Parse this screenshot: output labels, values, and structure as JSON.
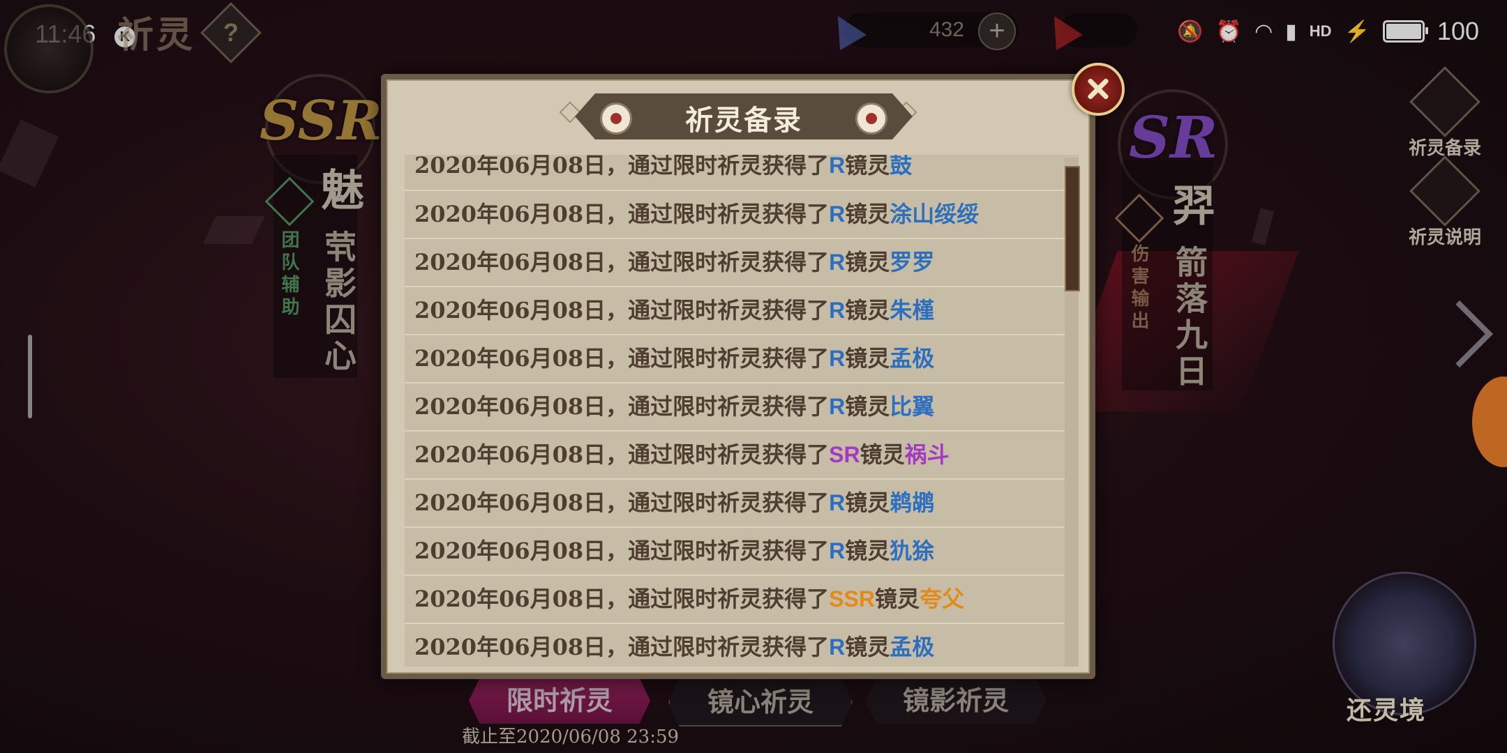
{
  "status_bar": {
    "time": "11:46",
    "notification_badge": "K",
    "battery": "100",
    "icons": [
      "mute-icon",
      "alarm-icon",
      "wifi-icon",
      "signal-icon",
      "hd-icon",
      "charging-icon"
    ]
  },
  "hud": {
    "title": "祈灵",
    "help_label": "?",
    "currency_1": {
      "value": "432",
      "plus": "+"
    },
    "currency_2": {
      "plus": "+"
    }
  },
  "left_hero": {
    "rank": "SSR",
    "name": "魅",
    "title": "茕影囚心",
    "role": "团队辅助"
  },
  "right_hero": {
    "rank": "SR",
    "name": "羿",
    "title": "箭落九日",
    "role": "伤害输出"
  },
  "side_buttons": {
    "record": "祈灵备录",
    "guide": "祈灵说明"
  },
  "realm": {
    "label": "还灵境"
  },
  "tabs": [
    {
      "label": "限时祈灵",
      "active": true
    },
    {
      "label": "镜心祈灵",
      "active": false
    },
    {
      "label": "镜影祈灵",
      "active": false
    }
  ],
  "deadline": "截止至2020/06/08 23:59",
  "modal": {
    "title": "祈灵备录",
    "entries": [
      {
        "date": "2020年06月08日，",
        "via": "通过限时祈灵获得了",
        "rarity": "R",
        "type": "镜灵",
        "name": "鼓"
      },
      {
        "date": "2020年06月08日，",
        "via": "通过限时祈灵获得了",
        "rarity": "R",
        "type": "镜灵",
        "name": "涂山绥绥"
      },
      {
        "date": "2020年06月08日，",
        "via": "通过限时祈灵获得了",
        "rarity": "R",
        "type": "镜灵",
        "name": "罗罗"
      },
      {
        "date": "2020年06月08日，",
        "via": "通过限时祈灵获得了",
        "rarity": "R",
        "type": "镜灵",
        "name": "朱槿"
      },
      {
        "date": "2020年06月08日，",
        "via": "通过限时祈灵获得了",
        "rarity": "R",
        "type": "镜灵",
        "name": "孟极"
      },
      {
        "date": "2020年06月08日，",
        "via": "通过限时祈灵获得了",
        "rarity": "R",
        "type": "镜灵",
        "name": "比翼"
      },
      {
        "date": "2020年06月08日，",
        "via": "通过限时祈灵获得了",
        "rarity": "SR",
        "type": "镜灵",
        "name": "祸斗"
      },
      {
        "date": "2020年06月08日，",
        "via": "通过限时祈灵获得了",
        "rarity": "R",
        "type": "镜灵",
        "name": "鹈鹕"
      },
      {
        "date": "2020年06月08日，",
        "via": "通过限时祈灵获得了",
        "rarity": "R",
        "type": "镜灵",
        "name": "犰狳"
      },
      {
        "date": "2020年06月08日，",
        "via": "通过限时祈灵获得了",
        "rarity": "SSR",
        "type": "镜灵",
        "name": "夸父"
      },
      {
        "date": "2020年06月08日，",
        "via": "通过限时祈灵获得了",
        "rarity": "R",
        "type": "镜灵",
        "name": "孟极"
      }
    ]
  },
  "colors": {
    "rarity_R": "#2c6fbf",
    "rarity_SR": "#a33ac0",
    "rarity_SSR": "#e28a1a",
    "panel": "#d2c8b4"
  }
}
